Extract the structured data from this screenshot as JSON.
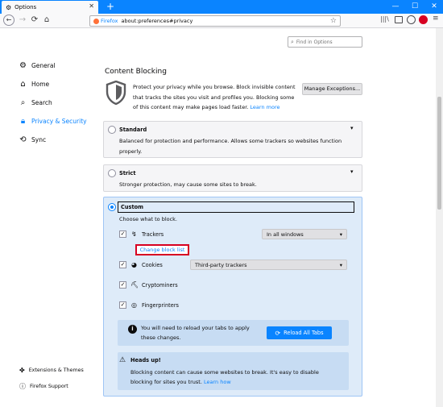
{
  "window": {
    "tab_title": "Options",
    "minimize": "—",
    "maximize": "☐",
    "close": "✕"
  },
  "nav": {
    "identity_label": "Firefox",
    "url": "about:preferences#privacy",
    "back": "←",
    "forward": "→",
    "reload": "⟳",
    "home": "⌂"
  },
  "search": {
    "placeholder": "Find in Options"
  },
  "sidebar": {
    "items": [
      {
        "label": "General",
        "icon": "gear-icon"
      },
      {
        "label": "Home",
        "icon": "home-icon"
      },
      {
        "label": "Search",
        "icon": "search-icon"
      },
      {
        "label": "Privacy & Security",
        "icon": "lock-icon"
      },
      {
        "label": "Sync",
        "icon": "sync-icon"
      }
    ],
    "footer": [
      {
        "label": "Extensions & Themes",
        "icon": "puzzle-icon"
      },
      {
        "label": "Firefox Support",
        "icon": "help-icon"
      }
    ]
  },
  "content_blocking": {
    "title": "Content Blocking",
    "description": "Protect your privacy while you browse. Block invisible content that tracks the sites you visit and profiles you. Blocking some of this content may make pages load faster.",
    "learn_more": "Learn more",
    "manage_button": "Manage Exceptions...",
    "options": {
      "standard": {
        "label": "Standard",
        "desc": "Balanced for protection and performance. Allows some trackers so websites function properly."
      },
      "strict": {
        "label": "Strict",
        "desc": "Stronger protection, may cause some sites to break."
      },
      "custom": {
        "label": "Custom",
        "desc": "Choose what to block."
      }
    },
    "custom_items": {
      "trackers": {
        "label": "Trackers",
        "checked": true,
        "dropdown": "In all windows"
      },
      "change_block_list": "Change block list",
      "cookies": {
        "label": "Cookies",
        "checked": true,
        "dropdown": "Third-party trackers"
      },
      "cryptominers": {
        "label": "Cryptominers",
        "checked": true
      },
      "fingerprinters": {
        "label": "Fingerprinters",
        "checked": true
      }
    },
    "reload_notice": "You will need to reload your tabs to apply these changes.",
    "reload_button": "Reload All Tabs",
    "heads_up": {
      "title": "Heads up!",
      "text": "Blocking content can cause some websites to break. It's easy to disable blocking for sites you trust.",
      "link": "Learn how"
    }
  },
  "colors": {
    "accent": "#0a84ff",
    "highlight": "#d70022",
    "custom_bg": "#deebf9"
  }
}
